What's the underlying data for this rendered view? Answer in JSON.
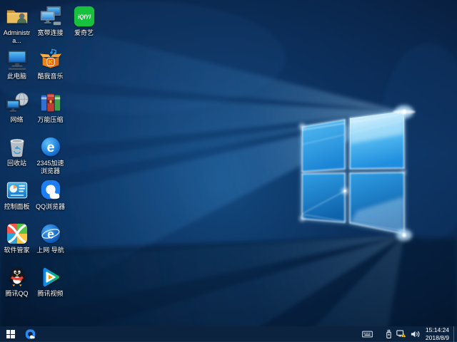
{
  "theme": {
    "taskbar_bg": "#0c2340",
    "label_color": "#ffffff",
    "tray_icon_color": "#dfe7ee",
    "warning_yellow": "#ffc400",
    "wallpaper_deep_blue": "#071a38",
    "wallpaper_beam_blue": "#2e8fe0",
    "window_pane_blue": "#1b85d6",
    "window_pane_light": "#bfe9ff"
  },
  "desktop": {
    "icons": [
      {
        "name": "administrator-folder",
        "label": "Administra..."
      },
      {
        "name": "this-pc",
        "label": "此电脑"
      },
      {
        "name": "network",
        "label": "网络"
      },
      {
        "name": "recycle-bin",
        "label": "回收站"
      },
      {
        "name": "control-panel",
        "label": "控制面板"
      },
      {
        "name": "software-manager",
        "label": "软件管家"
      },
      {
        "name": "tencent-qq",
        "label": "腾讯QQ"
      },
      {
        "name": "broadband-connection",
        "label": "宽带连接"
      },
      {
        "name": "kuwo-music",
        "label": "酷我音乐"
      },
      {
        "name": "wanneng-zip",
        "label": "万能压缩"
      },
      {
        "name": "2345-browser",
        "label": "2345加速浏览器"
      },
      {
        "name": "qq-browser",
        "label": "QQ浏览器"
      },
      {
        "name": "web-navigation",
        "label": "上网 导航"
      },
      {
        "name": "tencent-video",
        "label": "腾讯视频"
      },
      {
        "name": "iqiyi",
        "label": "爱奇艺"
      }
    ]
  },
  "icon_text": {
    "iqiyi": "iQIYI",
    "e2345": "e",
    "enav": "e",
    "kuwo_k": "K"
  },
  "taskbar": {
    "tray_icons": [
      "touch-keyboard",
      "usb-device",
      "network-warning",
      "volume"
    ],
    "clock": {
      "time": "15:14:24",
      "date": "2018/8/9"
    }
  }
}
